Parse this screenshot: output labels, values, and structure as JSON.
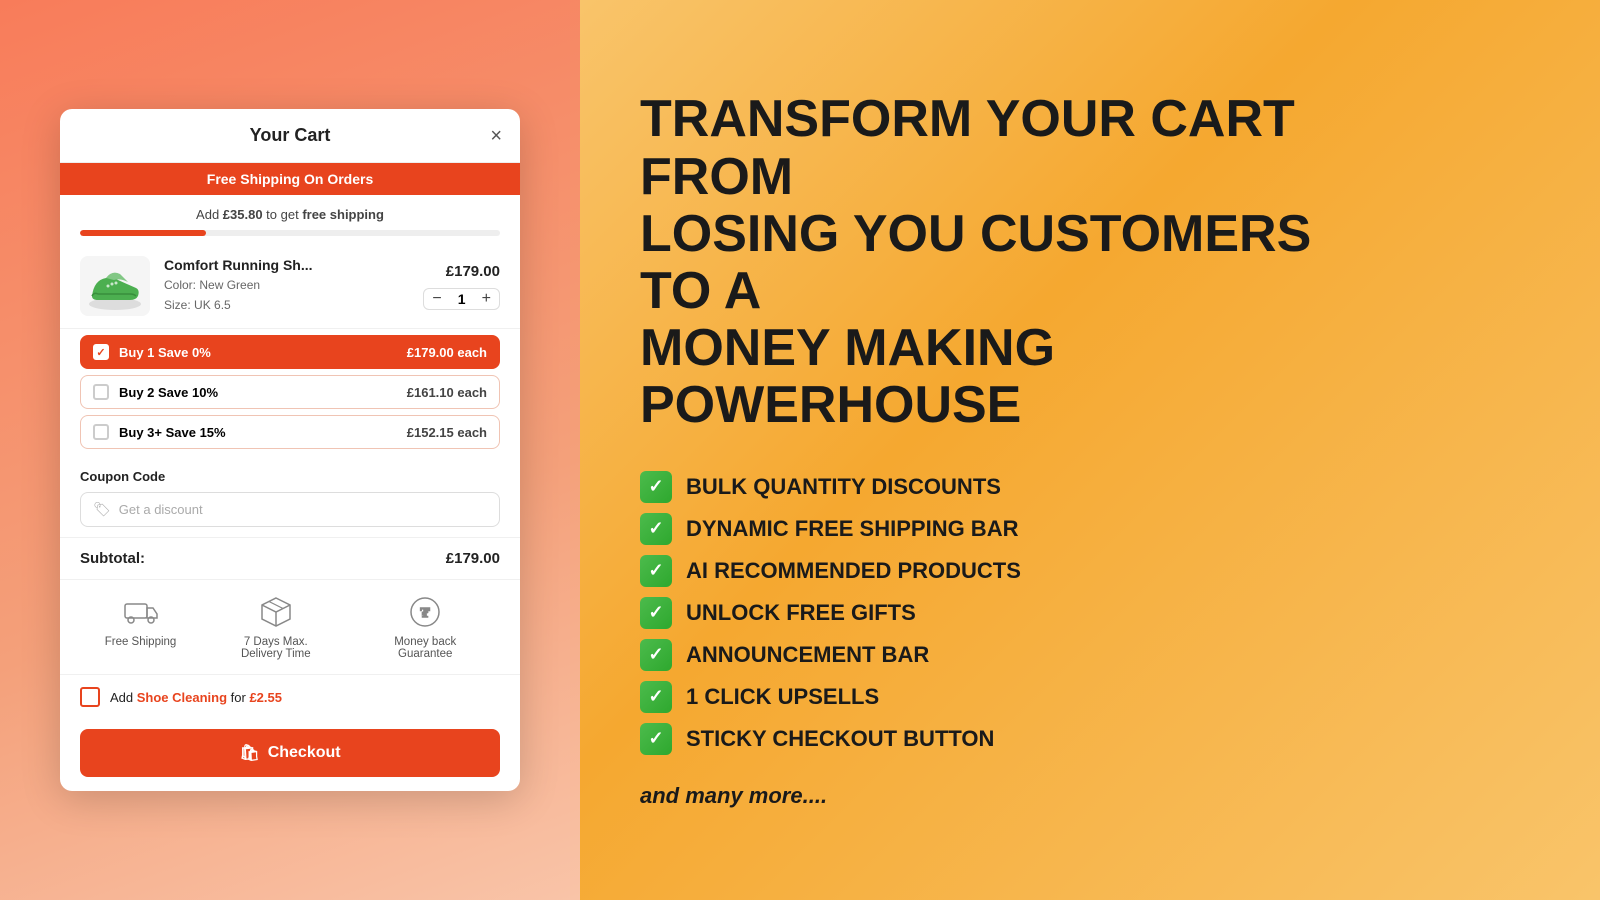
{
  "cart": {
    "title": "Your Cart",
    "close_label": "×",
    "banner": "Free Shipping On Orders",
    "shipping_progress": {
      "prefix": "Add ",
      "amount": "£35.80",
      "suffix": " to get ",
      "free_text": "free shipping"
    },
    "progress_percent": 30,
    "item": {
      "name": "Comfort Running Sh...",
      "price": "£179.00",
      "color_label": "Color:",
      "color_value": "New Green",
      "size_label": "Size:",
      "size_value": "UK 6.5",
      "quantity": "1"
    },
    "bulk_options": [
      {
        "label": "Buy 1 Save 0%",
        "price": "£179.00 each",
        "selected": true
      },
      {
        "label": "Buy 2 Save 10%",
        "price": "£161.10 each",
        "selected": false
      },
      {
        "label": "Buy 3+ Save 15%",
        "price": "£152.15 each",
        "selected": false
      }
    ],
    "coupon": {
      "label": "Coupon Code",
      "placeholder": "Get a discount"
    },
    "subtotal": {
      "label": "Subtotal:",
      "value": "£179.00"
    },
    "trust_badges": [
      {
        "icon": "truck",
        "label": "Free Shipping"
      },
      {
        "icon": "box",
        "label": "7 Days Max. Delivery Time"
      },
      {
        "icon": "guarantee",
        "label": "Money back Guarantee"
      }
    ],
    "upsell": {
      "prefix": "Add ",
      "product": "Shoe Cleaning",
      "middle": " for ",
      "price": "£2.55"
    },
    "checkout_label": "Checkout"
  },
  "promo": {
    "headline_line1": "TRANSFORM YOUR CART FROM",
    "headline_line2": "LOSING YOU CUSTOMERS TO A",
    "headline_line3": "MONEY MAKING POWERHOUSE",
    "features": [
      "BULK QUANTITY DISCOUNTS",
      "DYNAMIC FREE SHIPPING BAR",
      "AI RECOMMENDED PRODUCTS",
      "UNLOCK FREE GIFTS",
      "ANNOUNCEMENT BAR",
      "1 CLICK UPSELLS",
      "STICKY CHECKOUT BUTTON"
    ],
    "more": "and many more...."
  }
}
